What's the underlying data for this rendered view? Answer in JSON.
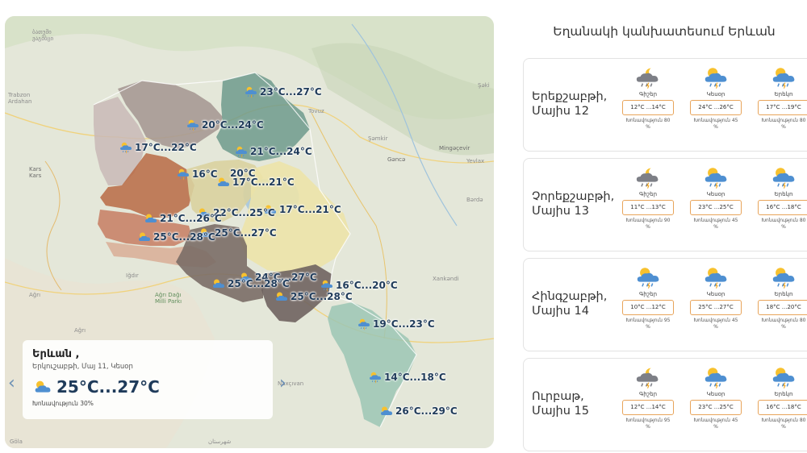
{
  "map": {
    "labels": [
      {
        "id": "batumi",
        "text": "ბათუმი\nვაგმბცი"
      },
      {
        "id": "trabzon",
        "text": "Trabzon\nArdahan"
      },
      {
        "id": "kars",
        "text": "Kars\nKars"
      },
      {
        "id": "agri",
        "text": "Ağrı"
      },
      {
        "id": "agri-dagi",
        "text": "Ağrı Dağı\nMilli Parkı"
      },
      {
        "id": "agri2",
        "text": "Ağrı"
      },
      {
        "id": "igdir",
        "text": "Iğdır"
      },
      {
        "id": "sheki",
        "text": "Şəki"
      },
      {
        "id": "shamkir",
        "text": "Şəmkir"
      },
      {
        "id": "ganca",
        "text": "Gəncə"
      },
      {
        "id": "mingacevir",
        "text": "Mingəçevir"
      },
      {
        "id": "yevlax",
        "text": "Yevlax"
      },
      {
        "id": "barda",
        "text": "Bərdə"
      },
      {
        "id": "khankendi",
        "text": "Xankəndi"
      },
      {
        "id": "nakhchivan",
        "text": "Naxçıvan"
      },
      {
        "id": "tovuz",
        "text": "Tovuz"
      },
      {
        "id": "gola",
        "text": "Göla"
      },
      {
        "id": "sarmar",
        "text": "شهرستان"
      }
    ],
    "markers": [
      {
        "id": "m1",
        "text": "23°C...27°C",
        "icon": "sun-cloud-rain-icon"
      },
      {
        "id": "m2",
        "text": "20°C...24°C",
        "icon": "sun-cloud-rain-icon"
      },
      {
        "id": "m3",
        "text": "17°C...22°C",
        "icon": "sun-cloud-rain-icon"
      },
      {
        "id": "m4",
        "text": "21°C...24°C",
        "icon": "sun-cloud-rain-icon"
      },
      {
        "id": "m5",
        "text": "16°C",
        "icon": "sun-cloud-rain-icon"
      },
      {
        "id": "m6",
        "text": "20°C",
        "icon": "sun-cloud-icon"
      },
      {
        "id": "m7",
        "text": "17°C...21°C",
        "icon": "sun-cloud-icon"
      },
      {
        "id": "m8",
        "text": "17°C...21°C",
        "icon": "sun-cloud-icon"
      },
      {
        "id": "m9",
        "text": "22°C...25°C",
        "icon": "sun-cloud-icon"
      },
      {
        "id": "m10",
        "text": "21°C...26°C",
        "icon": "sun-cloud-icon"
      },
      {
        "id": "m11",
        "text": "25°C...27°C",
        "icon": "sun-cloud-icon"
      },
      {
        "id": "m12",
        "text": "25°C...28°C",
        "icon": "sun-cloud-icon"
      },
      {
        "id": "m13",
        "text": "24°C...27°C",
        "icon": "sun-cloud-icon"
      },
      {
        "id": "m14",
        "text": "25°C...28°C",
        "icon": "sun-cloud-icon"
      },
      {
        "id": "m15",
        "text": "16°C...20°C",
        "icon": "sun-cloud-rain-icon"
      },
      {
        "id": "m16",
        "text": "25°C...28°C",
        "icon": "sun-cloud-icon"
      },
      {
        "id": "m17",
        "text": "19°C...23°C",
        "icon": "sun-cloud-rain-icon"
      },
      {
        "id": "m18",
        "text": "14°C...18°C",
        "icon": "sun-cloud-rain-icon"
      },
      {
        "id": "m19",
        "text": "26°C...29°C",
        "icon": "sun-cloud-icon"
      }
    ],
    "nav": {
      "prev": "‹",
      "next": "›"
    },
    "info": {
      "city": "Երևան ,",
      "date": "Երկուշաբթի, Մայ 11, Կեսօր",
      "temp": "25°C...27°C",
      "humidity": "Խոնավություն 30%"
    }
  },
  "forecast": {
    "title": "Եղանակի կանխատեսում Երևան",
    "days": [
      {
        "name": "Երեքշաբթի,\nՄայիս 12",
        "periods": [
          {
            "label": "Գիշեր",
            "range": "12°C ...14°C",
            "humidity": "Խոնավություն 80\n%",
            "icon": "moon-cloud-rain-icon"
          },
          {
            "label": "Կեսօր",
            "range": "24°C ...26°C",
            "humidity": "Խոնավություն 45\n%",
            "icon": "sun-cloud-rain-icon"
          },
          {
            "label": "Երեկո",
            "range": "17°C ...19°C",
            "humidity": "Խոնավություն 80\n%",
            "icon": "sun-cloud-rain-icon"
          }
        ]
      },
      {
        "name": "Չորեքշաբթի,\nՄայիս 13",
        "periods": [
          {
            "label": "Գիշեր",
            "range": "11°C ...13°C",
            "humidity": "Խոնավություն 90\n%",
            "icon": "moon-cloud-rain-icon"
          },
          {
            "label": "Կեսօր",
            "range": "23°C ...25°C",
            "humidity": "Խոնավություն 45\n%",
            "icon": "sun-cloud-rain-icon"
          },
          {
            "label": "Երեկո",
            "range": "16°C ...18°C",
            "humidity": "Խոնավություն 80\n%",
            "icon": "sun-cloud-rain-icon"
          }
        ]
      },
      {
        "name": "Հինգշաբթի,\nՄայիս 14",
        "periods": [
          {
            "label": "Գիշեր",
            "range": "10°C ...12°C",
            "humidity": "Խոնավություն 95\n%",
            "icon": "sun-cloud-rain-icon"
          },
          {
            "label": "Կեսօր",
            "range": "25°C ...27°C",
            "humidity": "Խոնավություն 45\n%",
            "icon": "sun-cloud-rain-icon"
          },
          {
            "label": "Երեկո",
            "range": "18°C ...20°C",
            "humidity": "Խոնավություն 80\n%",
            "icon": "sun-cloud-rain-icon"
          }
        ]
      },
      {
        "name": "Ուրբաթ,\nՄայիս 15",
        "periods": [
          {
            "label": "Գիշեր",
            "range": "12°C ...14°C",
            "humidity": "Խոնավություն 95\n%",
            "icon": "moon-cloud-rain-icon"
          },
          {
            "label": "Կեսօր",
            "range": "23°C ...25°C",
            "humidity": "Խոնավություն 45\n%",
            "icon": "sun-cloud-rain-icon"
          },
          {
            "label": "Երեկո",
            "range": "16°C ...18°C",
            "humidity": "Խոնավություն 80\n%",
            "icon": "sun-cloud-rain-icon"
          }
        ]
      }
    ]
  },
  "colors": {
    "accent": "#e8a45a",
    "temp_text": "#1f3b5a",
    "region_shirak": "#c9b8b6",
    "region_lori": "#a69993",
    "region_tavush": "#6e9a8c",
    "region_aragatsotn": "#b86a44",
    "region_kotayk": "#d9d29e",
    "region_gegharkunik": "#ece3a8",
    "region_armavir": "#c77d62",
    "region_ararat": "#7a6d66",
    "region_vayots_dzor": "#6f635f",
    "region_syunik": "#9cc5b4"
  }
}
